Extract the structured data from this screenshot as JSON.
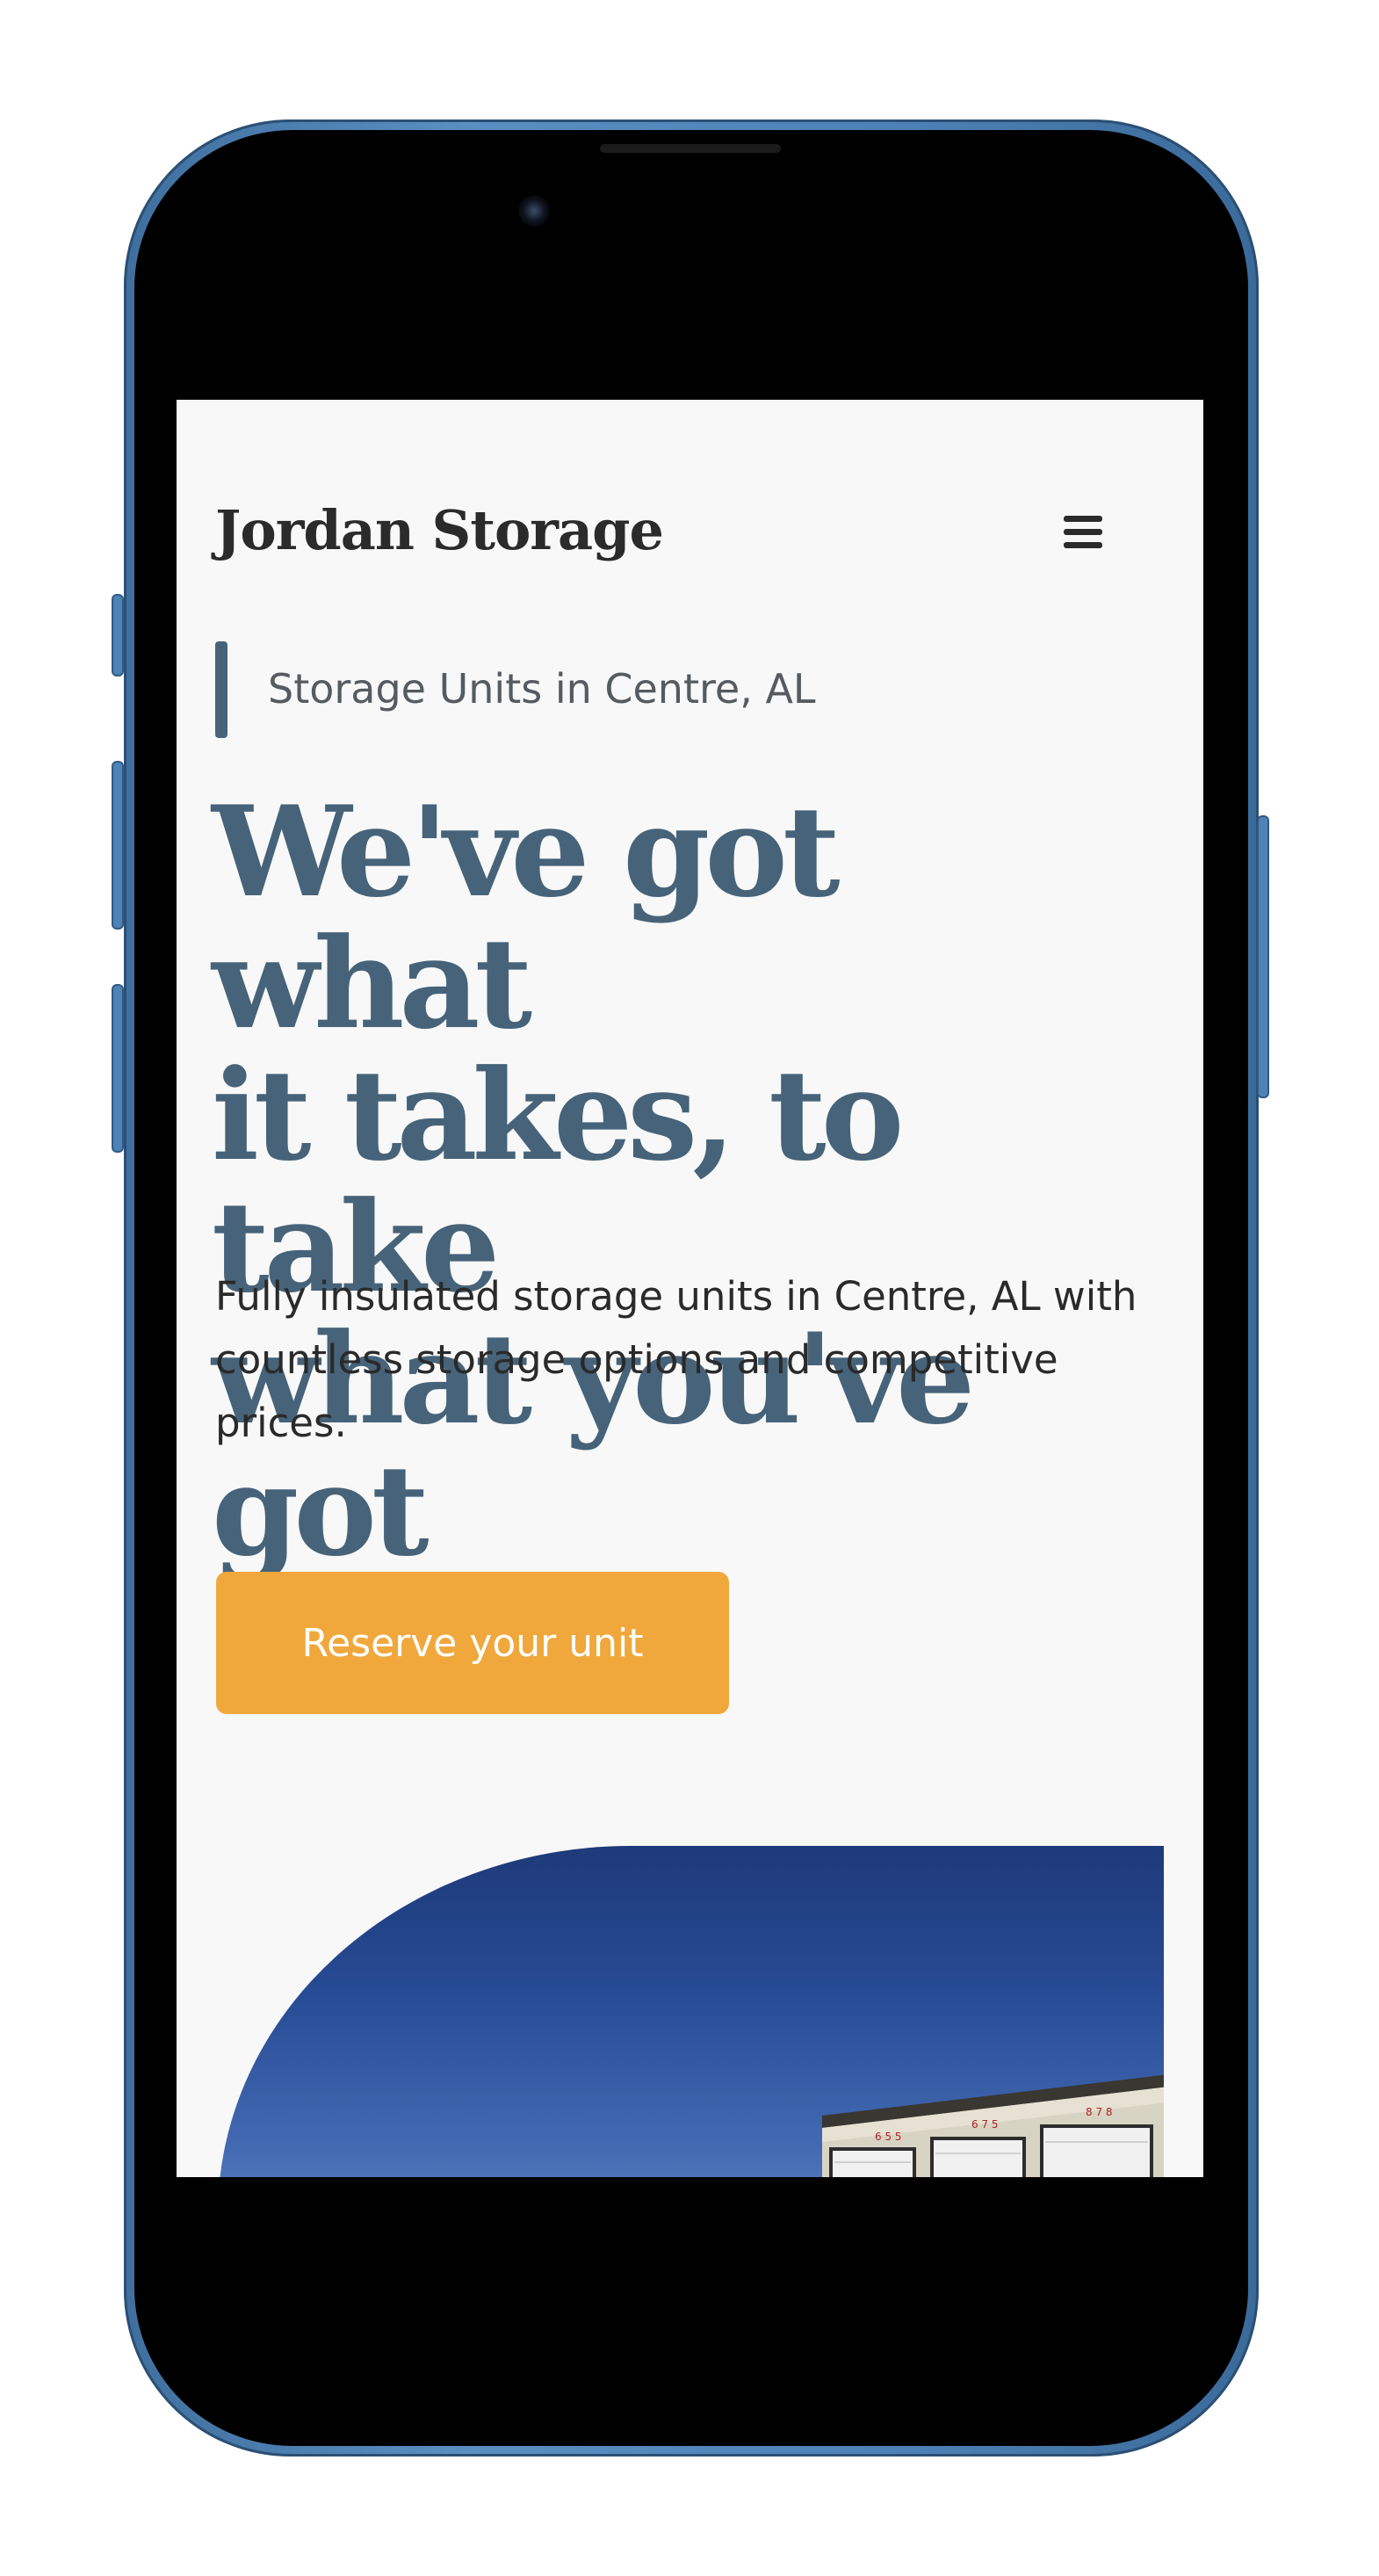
{
  "header": {
    "brand": "Jordan Storage",
    "menu_icon": "hamburger-menu-icon"
  },
  "hero": {
    "eyebrow": "Storage Units in Centre, AL",
    "headline_lines": [
      "We've got what",
      "it takes, to take",
      "what you've got"
    ],
    "subtext": "Fully insulated storage units in Centre, AL with countless storage options and competitive prices.",
    "cta_label": "Reserve your unit",
    "image_alt": "storage-building-photo"
  },
  "colors": {
    "accent": "#f0a83c",
    "heading": "#46637a",
    "text": "#2a2a2a",
    "background": "#f8f8f8",
    "phone_frame": "#4d80b4"
  }
}
